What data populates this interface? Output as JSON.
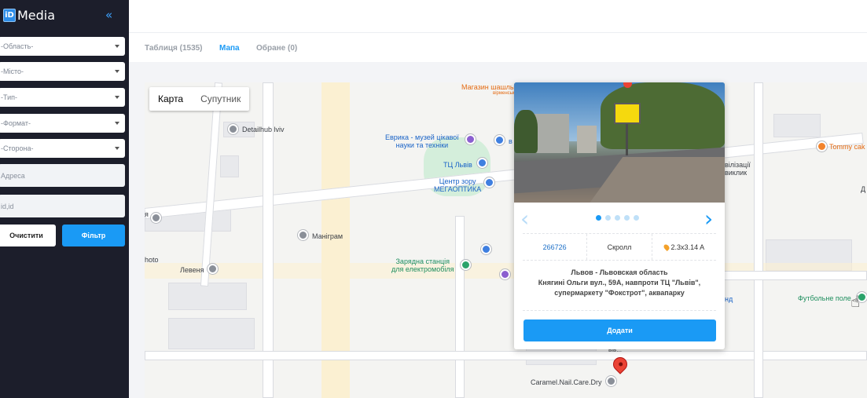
{
  "brand": {
    "logo_letters": "iD",
    "name": "Media"
  },
  "sidebar": {
    "collapse_icon": "«",
    "selects": [
      {
        "placeholder": "-Область-"
      },
      {
        "placeholder": "-Місто-"
      },
      {
        "placeholder": "-Тип-"
      },
      {
        "placeholder": "-Формат-"
      },
      {
        "placeholder": "-Сторона-"
      }
    ],
    "address_placeholder": "Адреса",
    "ids_placeholder": "id,id",
    "clear_label": "Очистити",
    "filter_label": "Фільтр"
  },
  "tabs": [
    {
      "label": "Таблиця (1535)",
      "active": false
    },
    {
      "label": "Мапа",
      "active": true
    },
    {
      "label": "Обране (0)",
      "active": false
    }
  ],
  "map": {
    "type_map": "Карта",
    "type_satellite": "Супутник",
    "pois": {
      "shop": "Магазин шашлы",
      "shop_sub": "вірменсько",
      "detailhub": "Detailhub lviv",
      "evrika_1": "Еврика - музей цікавої",
      "evrika_2": "науки та техніки",
      "tc_lviv": "ТЦ Львів",
      "optika_1": "Центр зору",
      "optika_2": "МЕГАОПТИКА",
      "manigram": "Маніграм",
      "ev_station_1": "Зарядна станція",
      "ev_station_2": "для електромобіля",
      "photo": "hoto",
      "levenya": "Левеня",
      "tommy": "Tommy cak",
      "football": "Футбольне поле",
      "caramel": "Caramel.Nail.Care.Dry",
      "partial_1": "вілізації",
      "partial_2": "виклик",
      "partial_3": "нд",
      "partial_4": "Д",
      "partial_5": "я",
      "partial_6": "в",
      "partial_7": "вів..."
    }
  },
  "popup": {
    "id": "266726",
    "type": "Скролл",
    "size": "2.3x3.14 A",
    "address_line1": "Львов - Львовская область",
    "address_line2": "Княгині Ольги вул., 59А, навпроти ТЦ \"Львів\",",
    "address_line3": "супермаркету \"Фокстрот\", аквапарку",
    "add_label": "Додати",
    "prev_icon": "‹",
    "next_icon": "›"
  },
  "colors": {
    "accent": "#1a9af5",
    "sidebar_bg": "#1c1e2b"
  }
}
